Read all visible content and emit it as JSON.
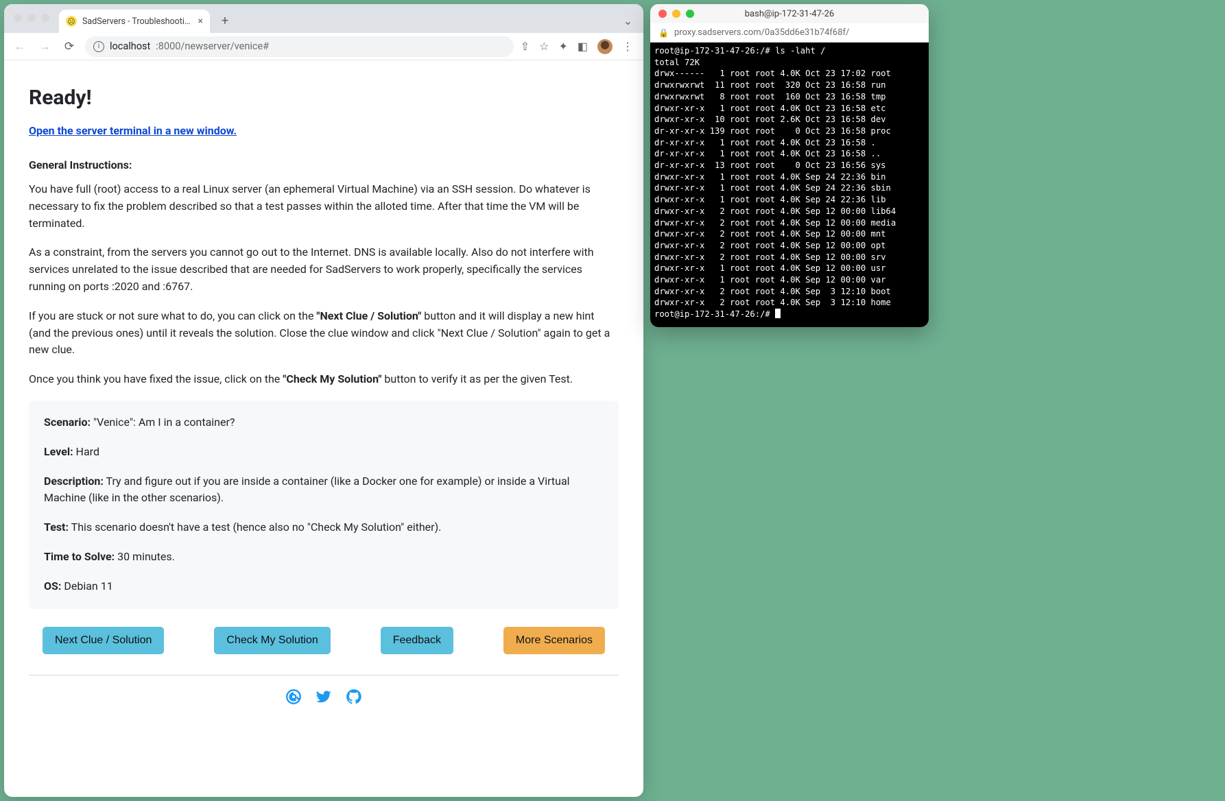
{
  "browser": {
    "tab_title": "SadServers - Troubleshooting",
    "url_host": "localhost",
    "url_port_path": ":8000/newserver/venice#"
  },
  "page": {
    "heading": "Ready!",
    "open_link": "Open the server terminal in a new window.",
    "instructions_heading": "General Instructions:",
    "p1": "You have full (root) access to a real Linux server (an ephemeral Virtual Machine) via an SSH session. Do whatever is necessary to fix the problem described so that a test passes within the alloted time. After that time the VM will be terminated.",
    "p2": "As a constraint, from the servers you cannot go out to the Internet. DNS is available locally. Also do not interfere with services unrelated to the issue described that are needed for SadServers to work properly, specifically the services running on ports :2020 and :6767.",
    "p3_a": "If you are stuck or not sure what to do, you can click on the ",
    "p3_btn1": "\"Next Clue / Solution\"",
    "p3_b": " button and it will display a new hint (and the previous ones) until it reveals the solution. Close the clue window and click \"Next Clue / Solution\" again to get a new clue.",
    "p4_a": "Once you think you have fixed the issue, click on the ",
    "p4_btn": "\"Check My Solution\"",
    "p4_b": " button to verify it as per the given Test."
  },
  "scenario": {
    "scenario_label": "Scenario:",
    "scenario_value": " \"Venice\": Am I in a container?",
    "level_label": "Level:",
    "level_value": " Hard",
    "description_label": "Description:",
    "description_value": " Try and figure out if you are inside a container (like a Docker one for example) or inside a Virtual Machine (like in the other scenarios).",
    "test_label": "Test:",
    "test_value": " This scenario doesn't have a test (hence also no \"Check My Solution\" either).",
    "tts_label": "Time to Solve:",
    "tts_value": " 30 minutes.",
    "os_label": "OS:",
    "os_value": " Debian 11"
  },
  "buttons": {
    "next_clue": "Next Clue / Solution",
    "check": "Check My Solution",
    "feedback": "Feedback",
    "more": "More Scenarios"
  },
  "terminal": {
    "title": "bash@ip-172-31-47-26",
    "url": "proxy.sadservers.com/0a35dd6e31b74f68f/",
    "prompt1": "root@ip-172-31-47-26:/# ",
    "cmd1": "ls -laht /",
    "total": "total 72K",
    "listing": [
      "drwx------   1 root root 4.0K Oct 23 17:02 root",
      "drwxrwxrwt  11 root root  320 Oct 23 16:58 run",
      "drwxrwxrwt   8 root root  160 Oct 23 16:58 tmp",
      "drwxr-xr-x   1 root root 4.0K Oct 23 16:58 etc",
      "drwxr-xr-x  10 root root 2.6K Oct 23 16:58 dev",
      "dr-xr-xr-x 139 root root    0 Oct 23 16:58 proc",
      "dr-xr-xr-x   1 root root 4.0K Oct 23 16:58 .",
      "dr-xr-xr-x   1 root root 4.0K Oct 23 16:58 ..",
      "dr-xr-xr-x  13 root root    0 Oct 23 16:56 sys",
      "drwxr-xr-x   1 root root 4.0K Sep 24 22:36 bin",
      "drwxr-xr-x   1 root root 4.0K Sep 24 22:36 sbin",
      "drwxr-xr-x   1 root root 4.0K Sep 24 22:36 lib",
      "drwxr-xr-x   2 root root 4.0K Sep 12 00:00 lib64",
      "drwxr-xr-x   2 root root 4.0K Sep 12 00:00 media",
      "drwxr-xr-x   2 root root 4.0K Sep 12 00:00 mnt",
      "drwxr-xr-x   2 root root 4.0K Sep 12 00:00 opt",
      "drwxr-xr-x   2 root root 4.0K Sep 12 00:00 srv",
      "drwxr-xr-x   1 root root 4.0K Sep 12 00:00 usr",
      "drwxr-xr-x   1 root root 4.0K Sep 12 00:00 var",
      "drwxr-xr-x   2 root root 4.0K Sep  3 12:10 boot",
      "drwxr-xr-x   2 root root 4.0K Sep  3 12:10 home"
    ],
    "prompt2": "root@ip-172-31-47-26:/# "
  }
}
